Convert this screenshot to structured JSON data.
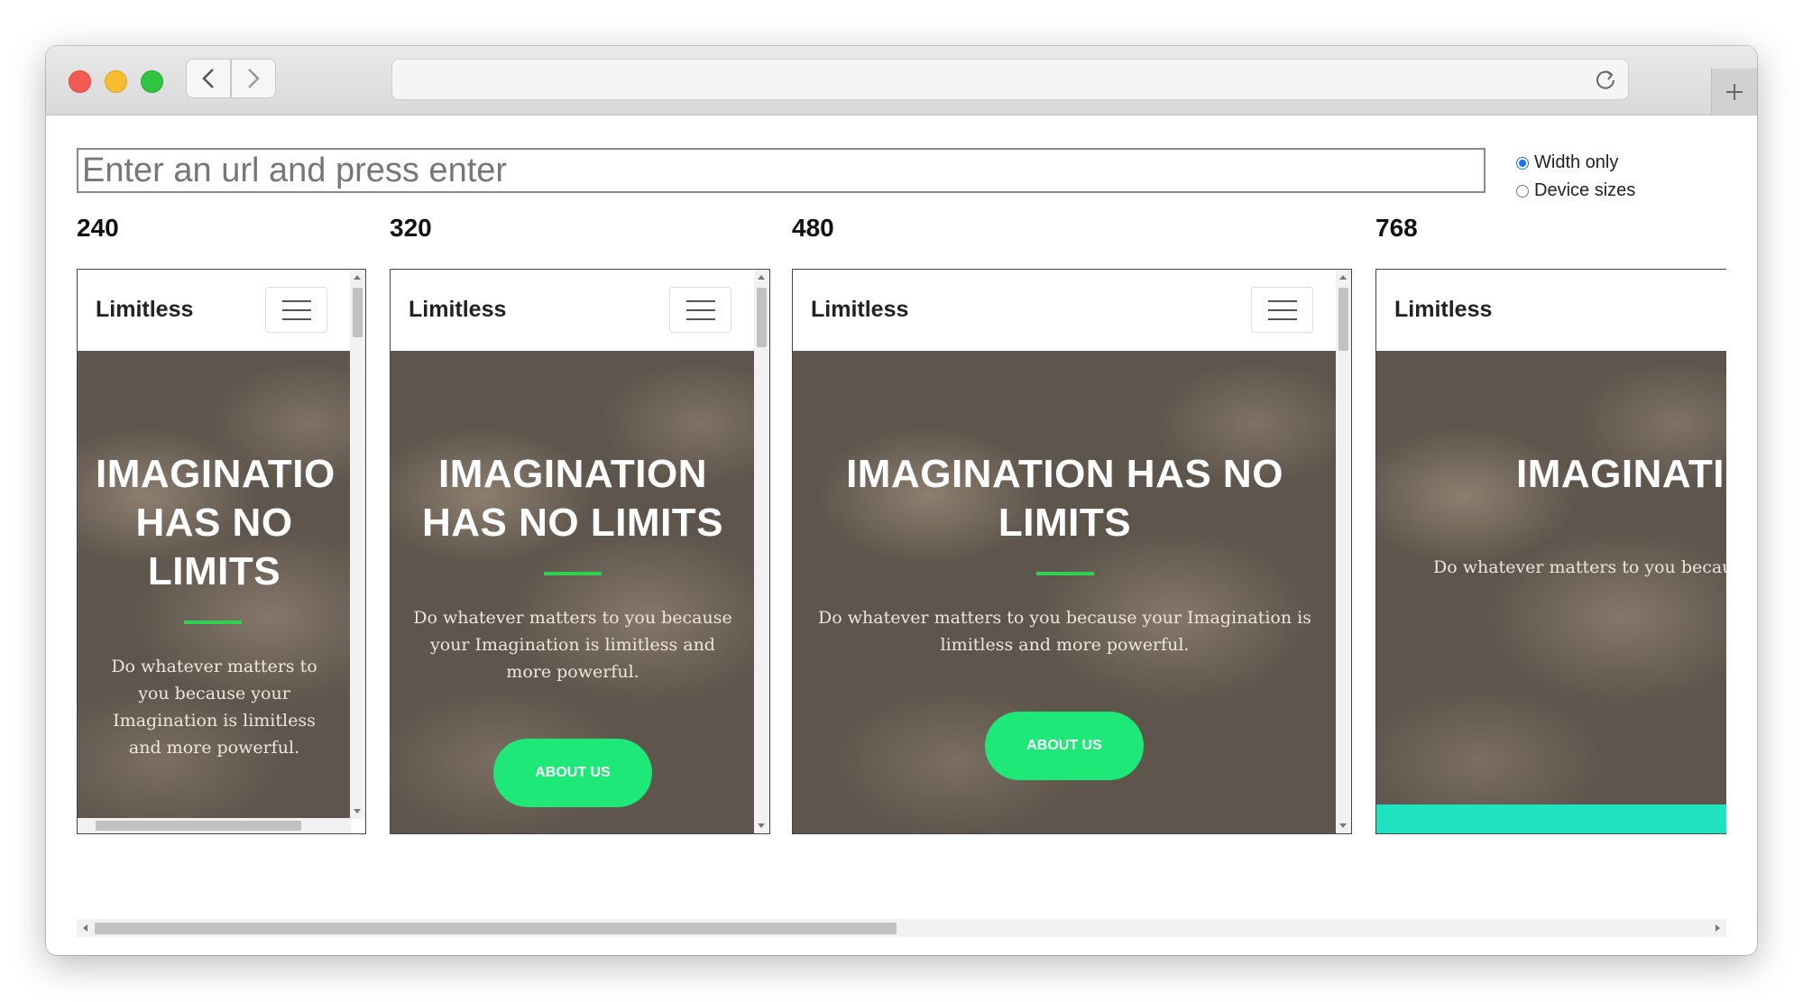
{
  "url_input": {
    "placeholder": "Enter an url and press enter"
  },
  "size_mode": {
    "options": [
      "Width only",
      "Device sizes"
    ],
    "selected": "Width only"
  },
  "previews": [
    {
      "width_label": "240",
      "brand": "Limitless",
      "title": "IMAGINATIO HAS NO LIMITS",
      "text": "Do whatever matters to you because your Imagination is limitless and more powerful."
    },
    {
      "width_label": "320",
      "brand": "Limitless",
      "title": "IMAGINATION HAS NO LIMITS",
      "text": "Do whatever matters to you because your Imagination is limitless and more powerful.",
      "button": "ABOUT US"
    },
    {
      "width_label": "480",
      "brand": "Limitless",
      "title": "IMAGINATION HAS NO LIMITS",
      "text": "Do whatever matters to you because your Imagination is limitless and more powerful.",
      "button": "ABOUT US"
    },
    {
      "width_label": "768",
      "brand": "Limitless",
      "title": "IMAGINATI",
      "text": "Do whatever matters to you becau"
    }
  ],
  "colors": {
    "accent_green": "#1ee877",
    "divider_green": "#2ed150",
    "teal": "#1fe3c0",
    "radio_blue": "#1a73e8"
  }
}
